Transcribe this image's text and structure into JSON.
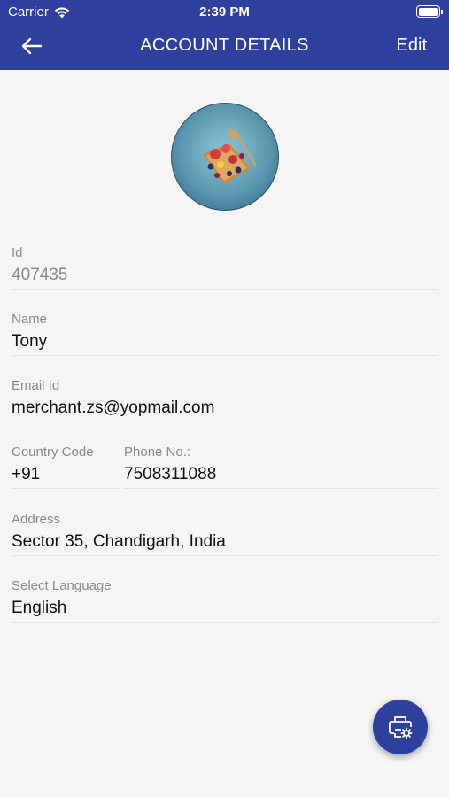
{
  "status_bar": {
    "carrier": "Carrier",
    "time": "2:39 PM"
  },
  "header": {
    "title": "ACCOUNT DETAILS",
    "edit_label": "Edit"
  },
  "fields": {
    "id": {
      "label": "Id",
      "value": "407435"
    },
    "name": {
      "label": "Name",
      "value": "Tony"
    },
    "email": {
      "label": "Email Id",
      "value": "merchant.zs@yopmail.com"
    },
    "country_code": {
      "label": "Country Code",
      "value": "+91"
    },
    "phone": {
      "label": "Phone No.:",
      "value": "7508311088"
    },
    "address": {
      "label": "Address",
      "value": "Sector 35, Chandigarh, India"
    },
    "language": {
      "label": "Select Language",
      "value": "English"
    }
  },
  "colors": {
    "primary": "#2f3f9e",
    "background": "#f5f5f5",
    "label": "#8a8a8a"
  },
  "icons": {
    "back": "arrow-left-icon",
    "fab": "printer-settings-icon"
  }
}
